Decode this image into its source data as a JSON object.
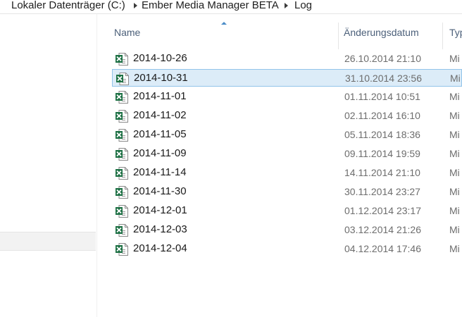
{
  "breadcrumb": [
    "Lokaler Datenträger (C:)",
    "Ember Media Manager BETA",
    "Log"
  ],
  "columns": {
    "name": "Name",
    "date": "Änderungsdatum",
    "type": "Typ"
  },
  "files": [
    {
      "name": "2014-10-26",
      "date": "26.10.2014 21:10",
      "type": "Mi"
    },
    {
      "name": "2014-10-31",
      "date": "31.10.2014 23:56",
      "type": "Mi",
      "selected": true
    },
    {
      "name": "2014-11-01",
      "date": "01.11.2014 10:51",
      "type": "Mi"
    },
    {
      "name": "2014-11-02",
      "date": "02.11.2014 16:10",
      "type": "Mi"
    },
    {
      "name": "2014-11-05",
      "date": "05.11.2014 18:36",
      "type": "Mi"
    },
    {
      "name": "2014-11-09",
      "date": "09.11.2014 19:59",
      "type": "Mi"
    },
    {
      "name": "2014-11-14",
      "date": "14.11.2014 21:10",
      "type": "Mi"
    },
    {
      "name": "2014-11-30",
      "date": "30.11.2014 23:27",
      "type": "Mi"
    },
    {
      "name": "2014-12-01",
      "date": "01.12.2014 23:17",
      "type": "Mi"
    },
    {
      "name": "2014-12-03",
      "date": "03.12.2014 21:26",
      "type": "Mi"
    },
    {
      "name": "2014-12-04",
      "date": "04.12.2014 17:46",
      "type": "Mi"
    }
  ],
  "icons": {
    "file": "excel-file-icon",
    "separator": "chevron-right-icon",
    "sort": "sort-ascending-icon"
  },
  "colors": {
    "excel_green": "#1e7145",
    "selection_bg": "#dcecf8",
    "selection_border": "#92c4ea",
    "header_text": "#4c607a"
  }
}
